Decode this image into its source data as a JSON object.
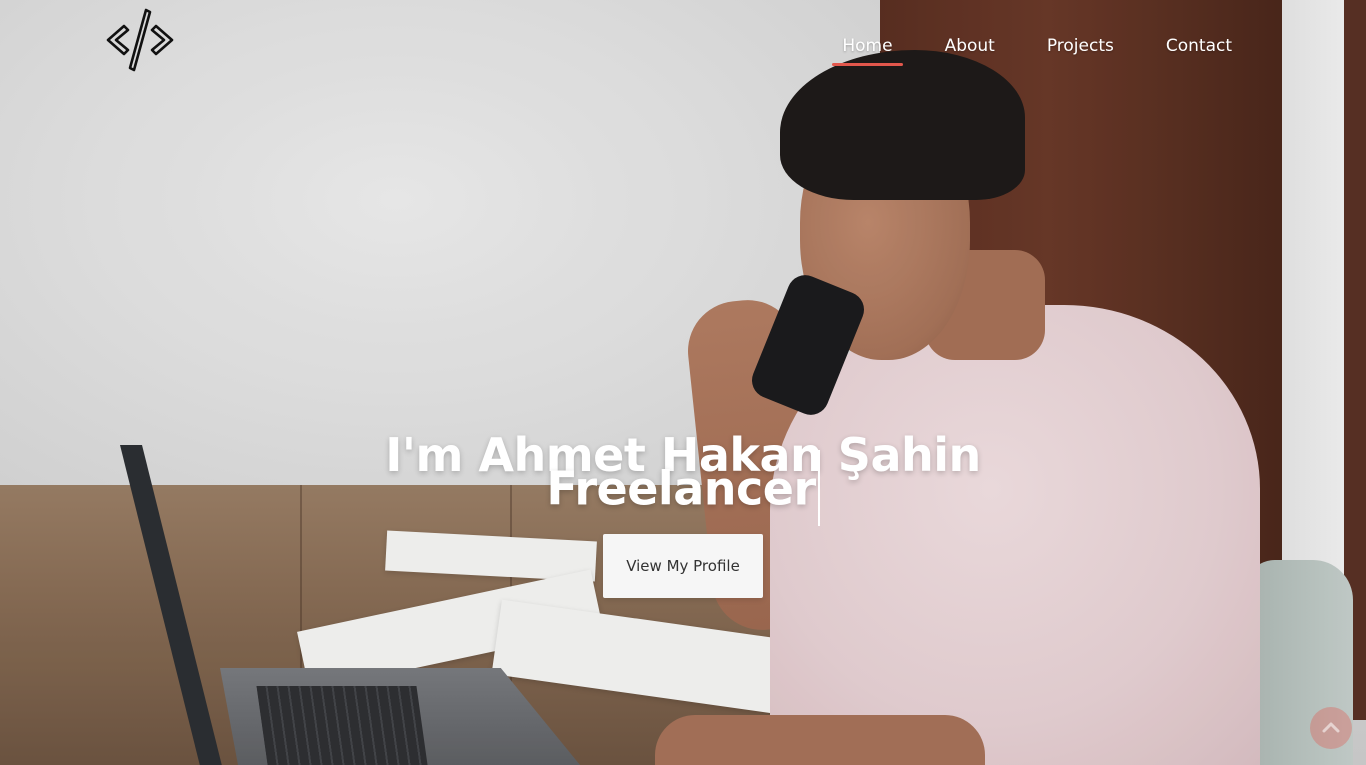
{
  "nav": {
    "logo_icon": "code-brackets-icon",
    "items": [
      {
        "label": "Home",
        "active": true
      },
      {
        "label": "About",
        "active": false
      },
      {
        "label": "Projects",
        "active": false
      },
      {
        "label": "Contact",
        "active": false
      }
    ]
  },
  "hero": {
    "title": "I'm Ahmet Hakan Şahin",
    "role": "Freelancer",
    "button_label": "View My Profile"
  },
  "scroll_top": {
    "icon": "chevron-up-icon"
  },
  "colors": {
    "accent": "#e2574c",
    "text_light": "#ffffff",
    "button_bg": "#f6f6f6"
  }
}
